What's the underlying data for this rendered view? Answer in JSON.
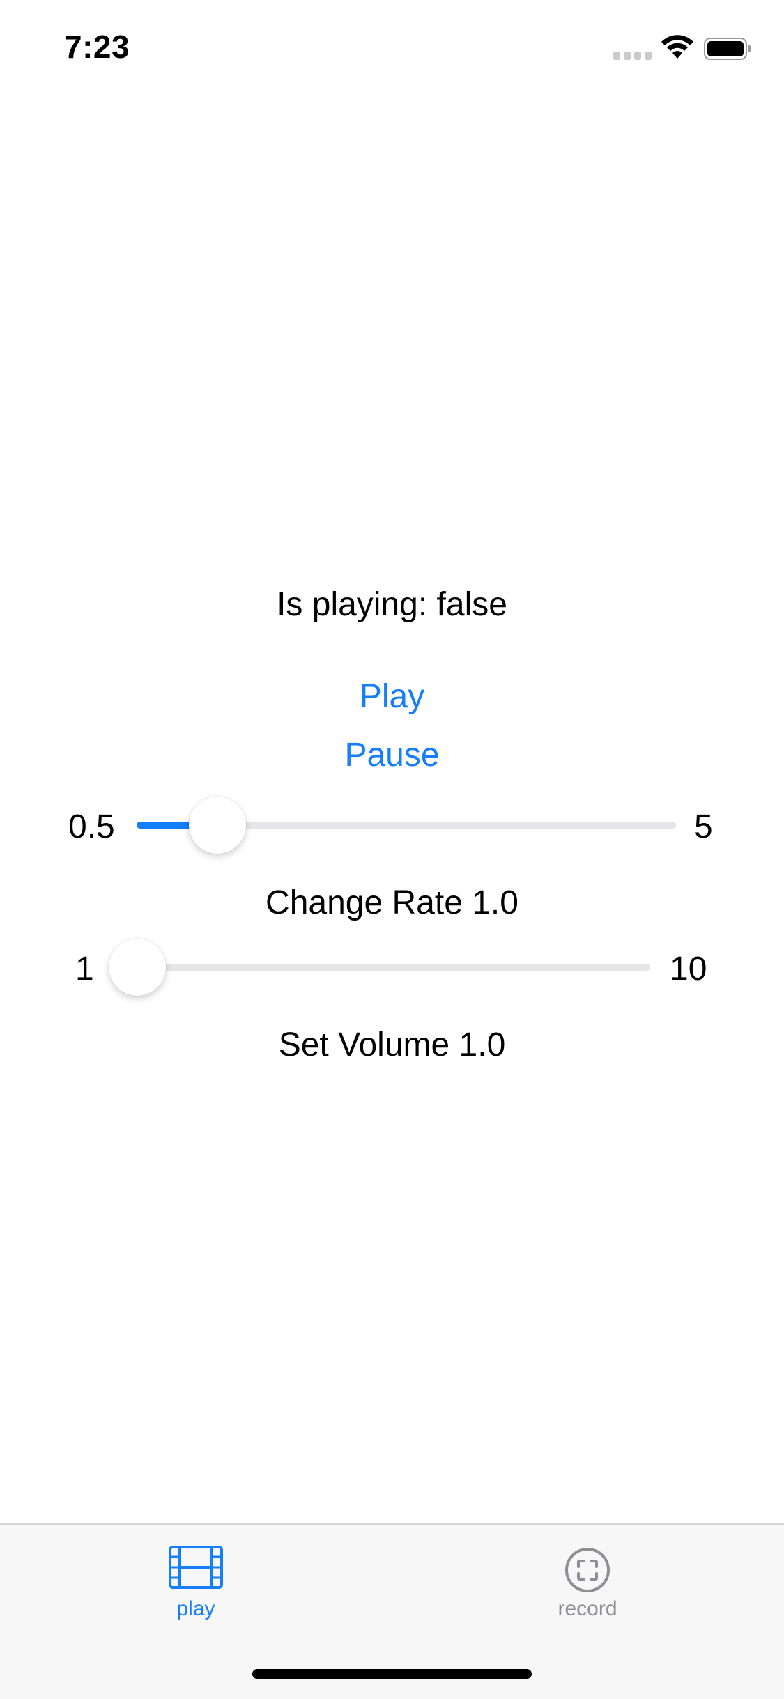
{
  "status_bar": {
    "time": "7:23",
    "signal_icon": "cellular-signal-icon",
    "wifi_icon": "wifi-icon",
    "battery_icon": "battery-icon"
  },
  "player": {
    "is_playing_text": "Is playing: false",
    "play_label": "Play",
    "pause_label": "Pause"
  },
  "rate_slider": {
    "min_label": "0.5",
    "max_label": "5",
    "min": 0.5,
    "max": 5,
    "value": 1.0,
    "caption": "Change Rate 1.0"
  },
  "volume_slider": {
    "min_label": "1",
    "max_label": "10",
    "min": 1,
    "max": 10,
    "value": 1.0,
    "caption": "Set Volume 1.0"
  },
  "tab_bar": {
    "tabs": [
      {
        "label": "play",
        "icon": "film-icon",
        "selected": true
      },
      {
        "label": "record",
        "icon": "record-icon",
        "selected": false
      }
    ]
  },
  "colors": {
    "accent": "#147EFB",
    "inactive": "#8e8e93",
    "track": "#e5e5ea",
    "tab_bar_background": "#f7f7f7"
  }
}
